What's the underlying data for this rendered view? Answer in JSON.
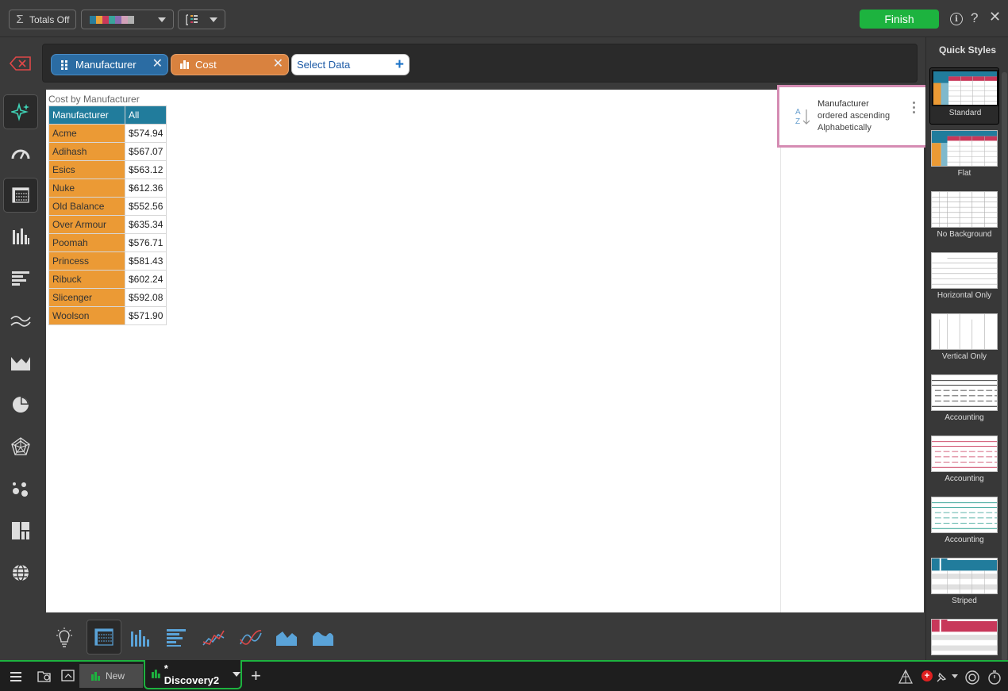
{
  "toolbar": {
    "totals_label": "Totals Off",
    "finish_label": "Finish",
    "palette_colors": [
      "#2a7d9b",
      "#e8a23a",
      "#c8385a",
      "#3aa39b",
      "#8a6bb0",
      "#d1a0b8",
      "#b0b0b0"
    ]
  },
  "data_bar": {
    "pills": [
      {
        "label": "Manufacturer",
        "color": "#2b6ca3"
      },
      {
        "label": "Cost",
        "color": "#d9823f"
      }
    ],
    "select_placeholder": "Select Data"
  },
  "grid": {
    "title": "Cost by Manufacturer",
    "headers": [
      "Manufacturer",
      "All"
    ],
    "rows": [
      {
        "label": "Acme",
        "value": "$574.94"
      },
      {
        "label": "Adihash",
        "value": "$567.07"
      },
      {
        "label": "Esics",
        "value": "$563.12"
      },
      {
        "label": "Nuke",
        "value": "$612.36"
      },
      {
        "label": "Old Balance",
        "value": "$552.56"
      },
      {
        "label": "Over Armour",
        "value": "$635.34"
      },
      {
        "label": "Poomah",
        "value": "$576.71"
      },
      {
        "label": "Princess",
        "value": "$581.43"
      },
      {
        "label": "Ribuck",
        "value": "$602.24"
      },
      {
        "label": "Slicenger",
        "value": "$592.08"
      },
      {
        "label": "Woolson",
        "value": "$571.90"
      }
    ]
  },
  "sort_card": {
    "line1": "Manufacturer",
    "line2": "ordered ascending",
    "line3": "Alphabetically"
  },
  "quick_styles": {
    "title": "Quick Styles",
    "items": [
      {
        "label": "Standard"
      },
      {
        "label": "Flat"
      },
      {
        "label": "No Background"
      },
      {
        "label": "Horizontal Only"
      },
      {
        "label": "Vertical Only"
      },
      {
        "label": "Accounting"
      },
      {
        "label": "Accounting"
      },
      {
        "label": "Accounting"
      },
      {
        "label": "Striped"
      }
    ]
  },
  "status_bar": {
    "tab_new": "New",
    "tab_discovery": "* Discovery2",
    "notification_count": "+"
  }
}
